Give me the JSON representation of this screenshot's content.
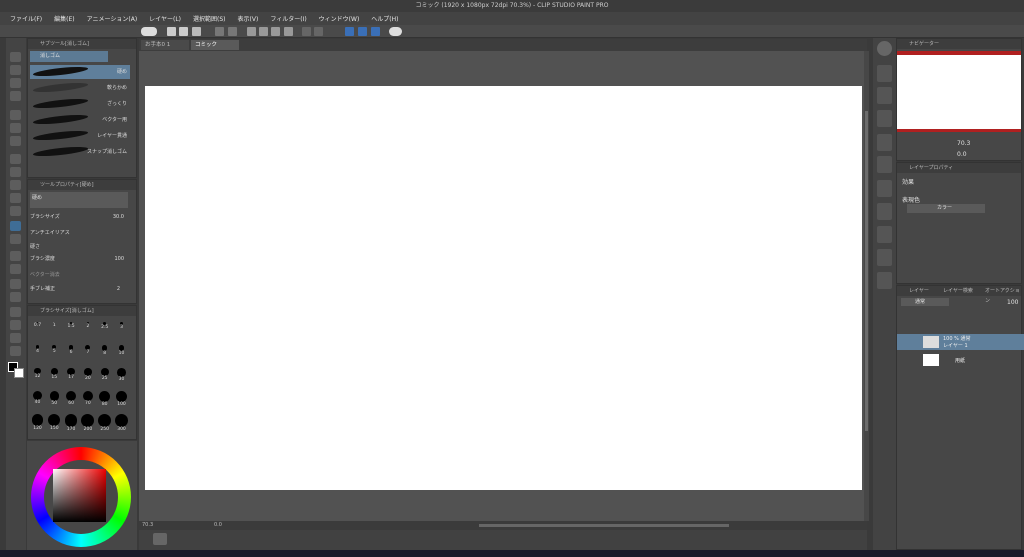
{
  "window": {
    "title": "コミック (1920 x 1080px 72dpi 70.3%) - CLIP STUDIO PAINT PRO"
  },
  "menu": [
    "ファイル(F)",
    "編集(E)",
    "アニメーション(A)",
    "レイヤー(L)",
    "選択範囲(S)",
    "表示(V)",
    "フィルター(I)",
    "ウィンドウ(W)",
    "ヘルプ(H)"
  ],
  "tabs": [
    {
      "label": "お手本0 1"
    },
    {
      "label": "コミック"
    }
  ],
  "sub_tool": {
    "header": "サブツール[消しゴム]",
    "active_tab": "消しゴム",
    "brushes": [
      "硬め",
      "軟らかめ",
      "ざっくり",
      "ベクター用",
      "レイヤー貫通",
      "スナップ消しゴム"
    ]
  },
  "tool_property": {
    "header": "ツールプロパティ[硬め]",
    "name": "硬め",
    "brush_size_label": "ブラシサイズ",
    "brush_size_value": "30.0",
    "antialias_label": "アンチエイリアス",
    "hardness_label": "硬さ",
    "density_label": "ブラシ濃度",
    "density_value": "100",
    "vector_label": "ベクター消去",
    "stabilize_label": "手ブレ補正",
    "stabilize_value": "2"
  },
  "brush_size_palette": {
    "header": "ブラシサイズ[消しゴム]",
    "rows": [
      [
        "0.7",
        "1",
        "1.5",
        "2",
        "2.5",
        "3"
      ],
      [
        "4",
        "5",
        "6",
        "7",
        "8",
        "10"
      ],
      [
        "12",
        "15",
        "17",
        "20",
        "25",
        "30"
      ],
      [
        "40",
        "50",
        "60",
        "70",
        "80",
        "100"
      ],
      [
        "120",
        "150",
        "170",
        "200",
        "250",
        "300"
      ]
    ]
  },
  "navigator": {
    "header": "ナビゲーター",
    "zoom": "70.3",
    "angle": "0.0"
  },
  "layer_property": {
    "header": "レイヤープロパティ",
    "effect_label": "効果",
    "expression_label": "表現色",
    "expression_value": "カラー"
  },
  "layers": {
    "header_tabs": [
      "レイヤー",
      "レイヤー検索",
      "オートアクション"
    ],
    "blend": "通常",
    "opacity": "100",
    "items": [
      {
        "title": "100 % 通常",
        "name": "レイヤー 1"
      },
      {
        "title": "",
        "name": "用紙"
      }
    ]
  },
  "status": {
    "zoom": "70.3",
    "angle": "0.0"
  },
  "colors": {
    "accent": "#5f7f9b",
    "canvas": "#ffffff",
    "bg": "#525252"
  }
}
